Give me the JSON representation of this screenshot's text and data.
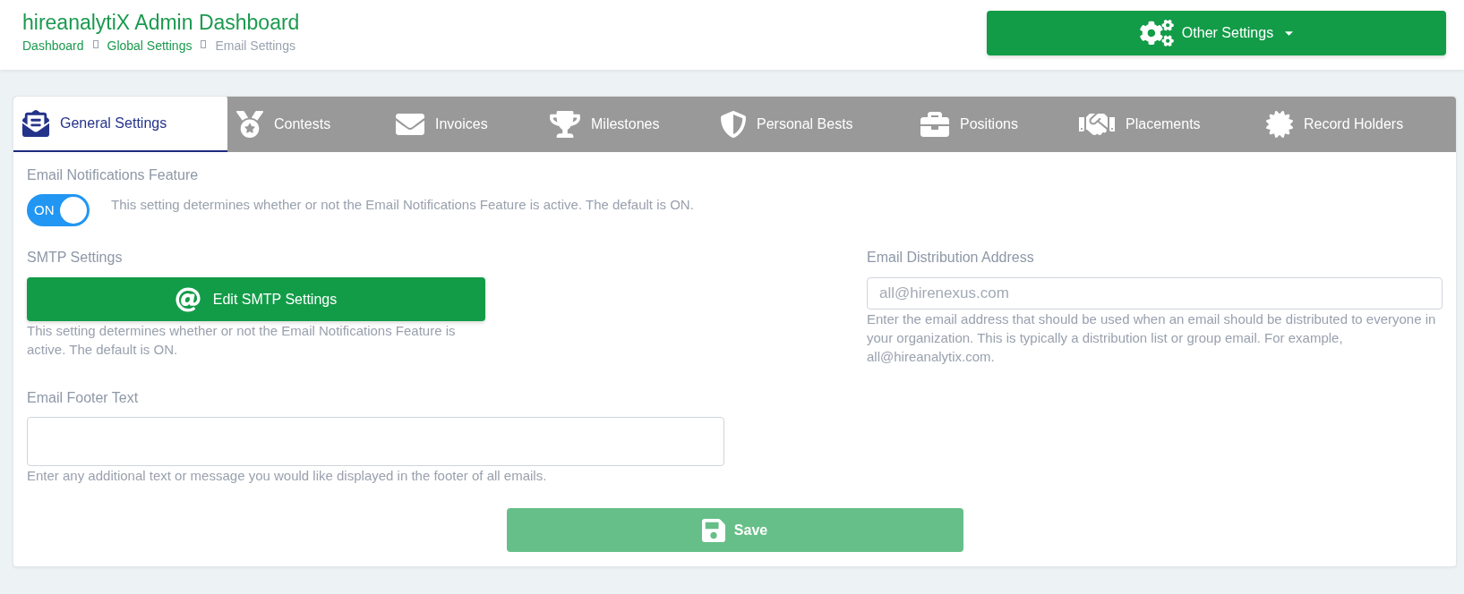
{
  "header": {
    "title": "hireanalytiX Admin Dashboard",
    "breadcrumb": [
      {
        "label": "Dashboard",
        "current": false
      },
      {
        "label": "Global Settings",
        "current": false
      },
      {
        "label": "Email Settings",
        "current": true
      }
    ],
    "other_settings_button": {
      "label": "Other Settings"
    }
  },
  "tabs": [
    {
      "label": "General Settings",
      "selected": true
    },
    {
      "label": "Contests",
      "selected": false
    },
    {
      "label": "Invoices",
      "selected": false
    },
    {
      "label": "Milestones",
      "selected": false
    },
    {
      "label": "Personal Bests",
      "selected": false
    },
    {
      "label": "Positions",
      "selected": false
    },
    {
      "label": "Placements",
      "selected": false
    },
    {
      "label": "Record Holders",
      "selected": false
    }
  ],
  "email_notifications": {
    "label": "Email Notifications Feature",
    "toggle": {
      "text": "ON",
      "on": true
    },
    "description": "This setting determines whether or not the Email Notifications Feature is active. The default is ON."
  },
  "smtp": {
    "label": "SMTP Settings",
    "button": "Edit SMTP Settings",
    "description": "This setting determines whether or not the Email Notifications Feature is active. The default is ON."
  },
  "distribution": {
    "label": "Email Distribution Address",
    "placeholder": "all@hirenexus.com",
    "description": "Enter the email address that should be used when an email should be distributed to everyone in your organization. This is typically a distribution list or group email. For example, all@hireanalytix.com."
  },
  "footer_text": {
    "label": "Email Footer Text",
    "description": "Enter any additional text or message you would like displayed in the footer of all emails."
  },
  "save_button": {
    "label": "Save",
    "disabled": true
  }
}
